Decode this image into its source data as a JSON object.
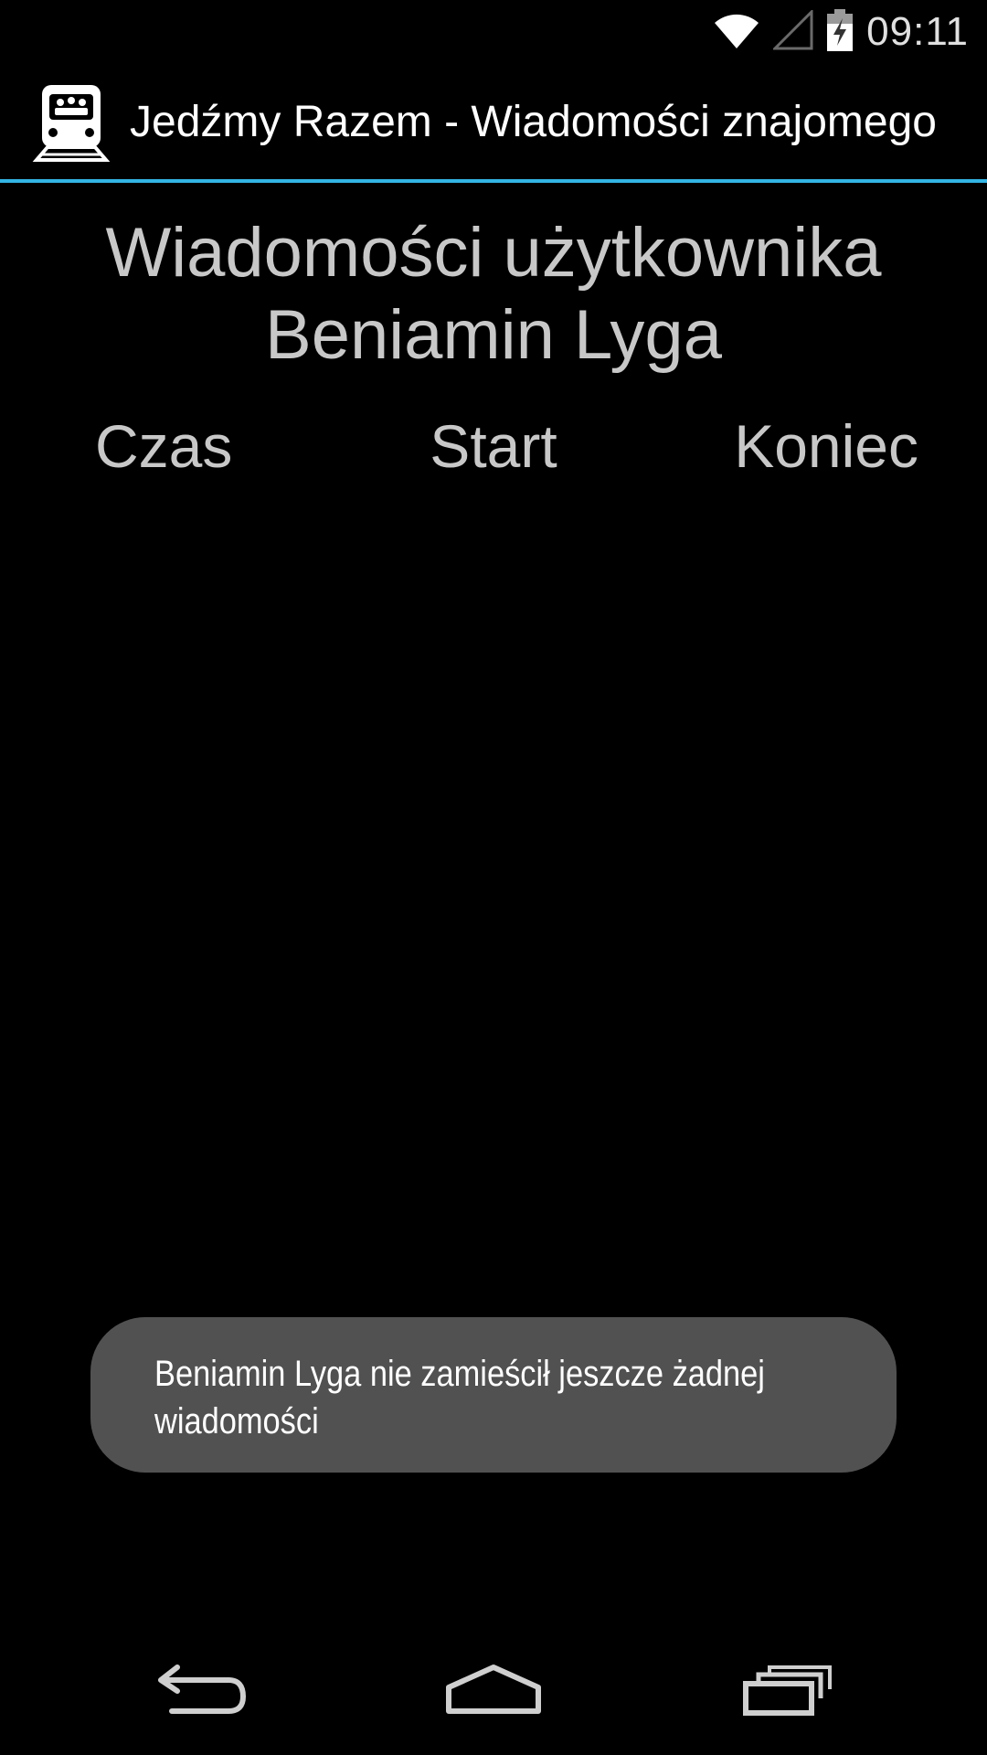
{
  "status_bar": {
    "time": "09:11",
    "icons": [
      "wifi-icon",
      "cell-signal-icon",
      "battery-charging-icon"
    ]
  },
  "action_bar": {
    "logo_icon": "train-people-icon",
    "title": "Jedźmy Razem - Wiadomości znajomego",
    "divider_color": "#33b5e5"
  },
  "main": {
    "heading_line1": "Wiadomości użytkownika",
    "heading_line2": "Beniamin Lyga",
    "columns": [
      "Czas",
      "Start",
      "Koniec"
    ]
  },
  "toast": {
    "message_line1": "Beniamin Lyga nie zamieścił jeszcze żadnej",
    "message_line2": "wiadomości"
  },
  "nav_bar": {
    "buttons": [
      "back-icon",
      "home-icon",
      "recent-apps-icon"
    ]
  }
}
